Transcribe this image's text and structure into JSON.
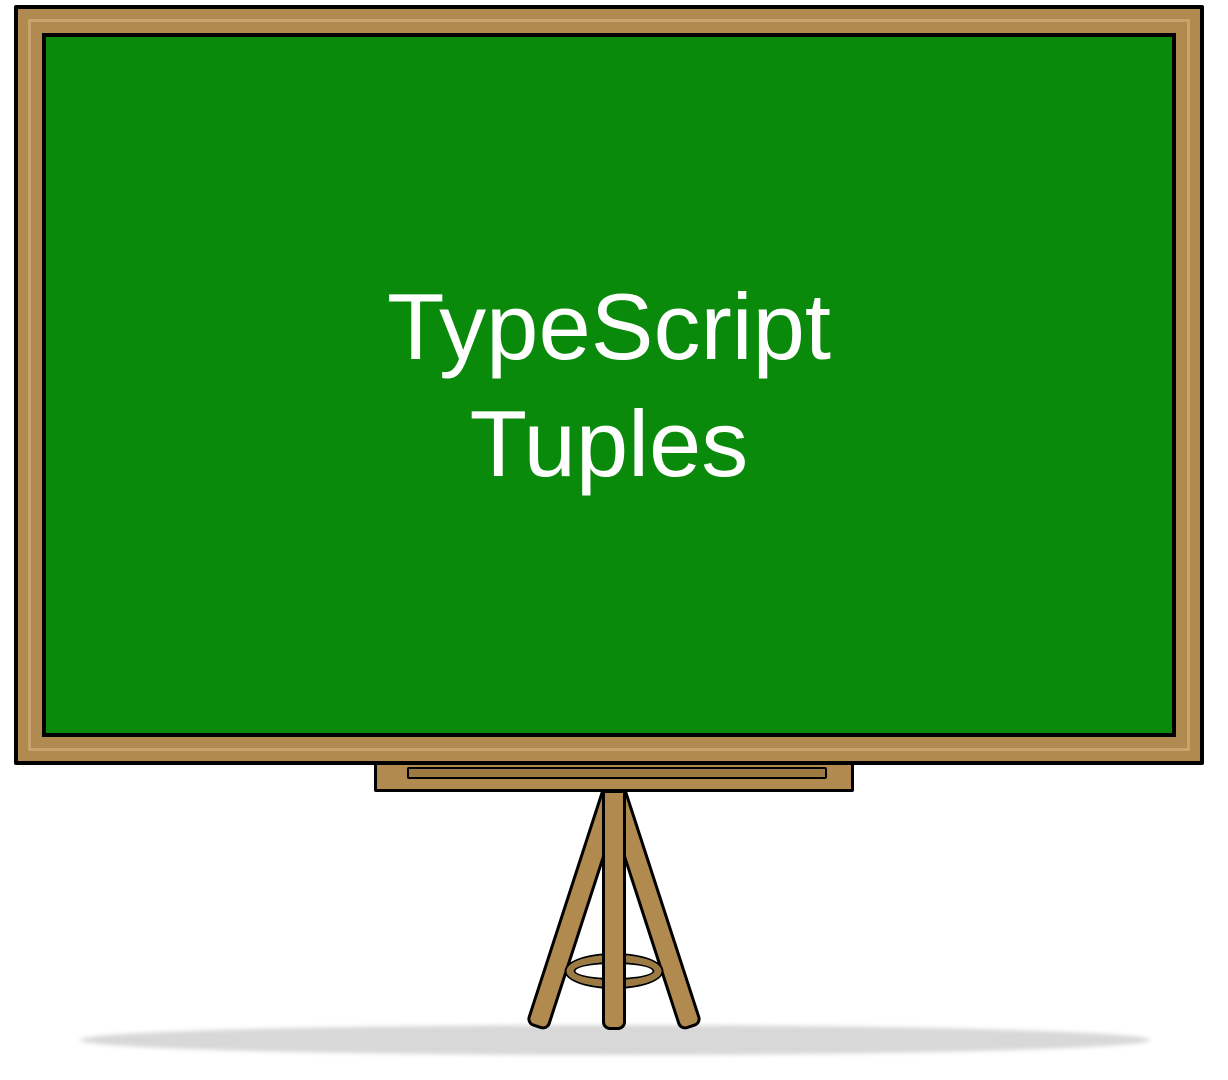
{
  "chalkboard": {
    "title_line1": "TypeScript",
    "title_line2": "Tuples"
  },
  "colors": {
    "board_green": "#0a8a0a",
    "frame_wood": "#b08a4e",
    "frame_highlight": "#c9a56d",
    "text": "#ffffff",
    "shadow": "#d8d8d8"
  }
}
